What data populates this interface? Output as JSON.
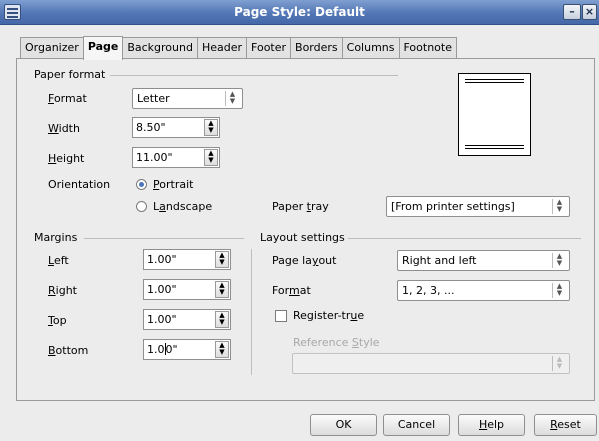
{
  "window": {
    "title": "Page Style: Default"
  },
  "tabs": [
    "Organizer",
    "Page",
    "Background",
    "Header",
    "Footer",
    "Borders",
    "Columns",
    "Footnote"
  ],
  "active_tab": "Page",
  "paper_format": {
    "section_label": "Paper format",
    "format_label": "Format",
    "format_value": "Letter",
    "width_label": "Width",
    "width_value": "8.50\"",
    "height_label": "Height",
    "height_value": "11.00\"",
    "orientation_label": "Orientation",
    "portrait_label": "Portrait",
    "landscape_label": "Landscape",
    "orientation_selected": "Portrait",
    "paper_tray_label": "Paper tray",
    "paper_tray_value": "[From printer settings]"
  },
  "margins": {
    "section_label": "Margins",
    "left_label": "Left",
    "left_value": "1.00\"",
    "right_label": "Right",
    "right_value": "1.00\"",
    "top_label": "Top",
    "top_value": "1.00\"",
    "bottom_label": "Bottom",
    "bottom_value_a": "1.0",
    "bottom_value_b": "0\""
  },
  "layout": {
    "section_label": "Layout settings",
    "page_layout_label": "Page layout",
    "page_layout_value": "Right and left",
    "format_label": "Format",
    "format_value": "1, 2, 3, ...",
    "register_true_label": "Register-true",
    "register_true_checked": false,
    "reference_style_label": "Reference Style",
    "reference_style_value": ""
  },
  "buttons": {
    "ok": "OK",
    "cancel": "Cancel",
    "help": "Help",
    "reset": "Reset"
  }
}
